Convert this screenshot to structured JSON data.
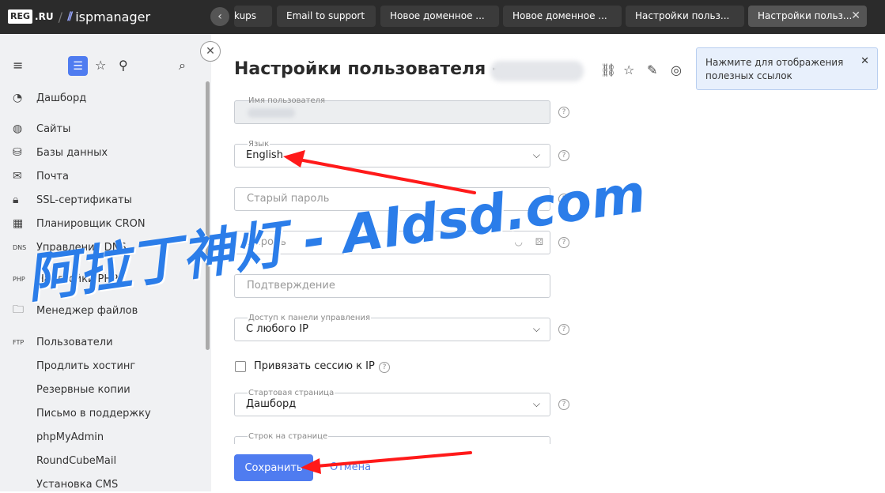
{
  "topbar": {
    "brand_reg": "REG",
    "brand_ru": ".RU",
    "brand_slash": "/",
    "brand_isp": "ispmanager",
    "back_icon": "chevron-left-icon",
    "tabs": [
      {
        "label": "kups",
        "active": false
      },
      {
        "label": "Email to support",
        "active": false
      },
      {
        "label": "Новое доменное ...",
        "active": false
      },
      {
        "label": "Новое доменное ...",
        "active": false
      },
      {
        "label": "Настройки польз...",
        "active": false
      },
      {
        "label": "Настройки польз...",
        "active": true
      }
    ]
  },
  "sidebar": {
    "items": [
      {
        "label": "Дашборд",
        "icon": "clock-icon"
      },
      {
        "label": "Сайты",
        "icon": "globe-icon"
      },
      {
        "label": "Базы данных",
        "icon": "database-icon"
      },
      {
        "label": "Почта",
        "icon": "mail-icon"
      },
      {
        "label": "SSL-сертификаты",
        "icon": "lock-icon"
      },
      {
        "label": "Планировщик CRON",
        "icon": "calendar-icon"
      },
      {
        "label": "Управление DNS",
        "icon": "dns-icon"
      },
      {
        "label": "Настройки PHP",
        "icon": "php-icon"
      },
      {
        "label": "Менеджер файлов",
        "icon": "folder-icon"
      },
      {
        "label": "Пользователи",
        "icon": "ftp-icon"
      },
      {
        "label": "Продлить хостинг",
        "icon": ""
      },
      {
        "label": "Резервные копии",
        "icon": ""
      },
      {
        "label": "Письмо в поддержку",
        "icon": ""
      },
      {
        "label": "phpMyAdmin",
        "icon": ""
      },
      {
        "label": "RoundCubeMail",
        "icon": ""
      },
      {
        "label": "Установка CMS",
        "icon": ""
      }
    ],
    "icon_menu": "≡",
    "icon_list": "☰",
    "icon_star": "☆",
    "icon_cursor": "⚲",
    "icon_search": "⌕",
    "icon_dns": "DNS",
    "icon_php": "PHP",
    "icon_ftp": "FTP",
    "close_glyph": "✕"
  },
  "main": {
    "title": "Настройки пользователя -",
    "tooltip": "Нажмите для отображения полезных ссылок",
    "tooltip_close": "✕",
    "fields": {
      "username_label": "Имя пользователя",
      "language_label": "Язык",
      "language_value": "English",
      "old_password_placeholder": "Старый пароль",
      "password_placeholder": "Пароль",
      "confirm_placeholder": "Подтверждение",
      "access_label": "Доступ к панели управления",
      "access_value": "С любого IP",
      "bind_session_label": "Привязать сессию к IP",
      "start_page_label": "Стартовая страница",
      "start_page_value": "Дашборд",
      "rows_label": "Строк на странице"
    },
    "help_glyph": "?",
    "chevron_glyph": "⌵",
    "eye_glyph": "◡",
    "gen_glyph": "⚄",
    "tool_link": "⛓",
    "tool_star": "☆",
    "tool_pin": "✎",
    "tool_lifebuoy": "◎",
    "save_label": "Сохранить",
    "cancel_label": "Отмена"
  },
  "overlay": {
    "watermark": "阿拉丁神灯 - Aldsd.com",
    "arrow_color": "#ff1a1a"
  }
}
